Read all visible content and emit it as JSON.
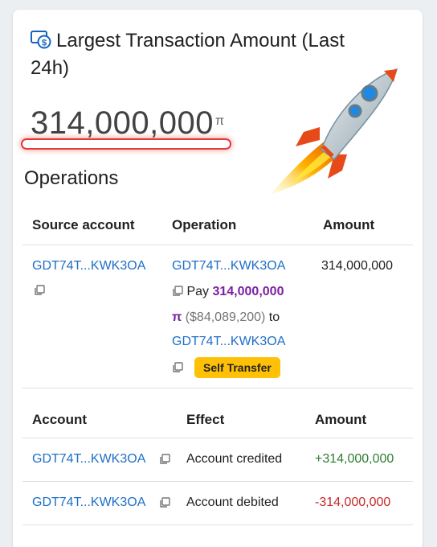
{
  "card": {
    "title": "Largest Transaction Amount (Last 24h)",
    "amount": "314,000,000",
    "unit": "π"
  },
  "operations": {
    "heading": "Operations",
    "headers": {
      "source": "Source account",
      "operation": "Operation",
      "amount": "Amount"
    },
    "row": {
      "source": "GDT74T...KWK3OA",
      "op_account": "GDT74T...KWK3OA",
      "pay_label": "Pay",
      "pay_amount": "314,000,000",
      "pay_unit": "π",
      "usd": "($84,089,200)",
      "to_label": "to",
      "to_account": "GDT74T...KWK3OA",
      "badge": "Self Transfer",
      "amount": "314,000,000"
    }
  },
  "effects": {
    "headers": {
      "account": "Account",
      "effect": "Effect",
      "amount": "Amount"
    },
    "rows": [
      {
        "account": "GDT74T...KWK3OA",
        "effect": "Account credited",
        "amount": "+314,000,000"
      },
      {
        "account": "GDT74T...KWK3OA",
        "effect": "Account debited",
        "amount": "-314,000,000"
      }
    ]
  },
  "colors": {
    "link": "#1e6fc7",
    "pi_amount": "#7b1fa2",
    "credit": "#2e7d32",
    "debit": "#c62828",
    "badge": "#ffc107"
  },
  "icons": [
    "money-bill-icon",
    "copy-icon",
    "rocket-icon"
  ]
}
